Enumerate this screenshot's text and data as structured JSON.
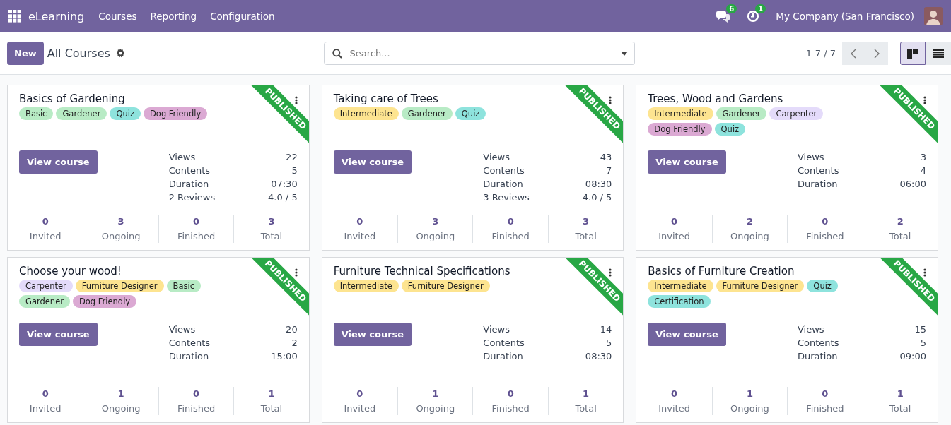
{
  "navbar": {
    "app_name": "eLearning",
    "menu": [
      "Courses",
      "Reporting",
      "Configuration"
    ],
    "messages_count": "6",
    "activities_count": "1",
    "company": "My Company (San Francisco)"
  },
  "control_panel": {
    "new_button": "New",
    "breadcrumb": "All Courses",
    "search": {
      "placeholder": "Search..."
    },
    "pager": "1-7 / 7",
    "views": [
      {
        "kind": "kanban",
        "selected": true
      },
      {
        "kind": "list",
        "selected": false
      }
    ]
  },
  "courses": [
    {
      "title": "Basics of Gardening",
      "ribbon": "PUBLISHED",
      "tags": [
        {
          "label": "Basic",
          "color": "#b8ebc5"
        },
        {
          "label": "Gardener",
          "color": "#b8ebc5"
        },
        {
          "label": "Quiz",
          "color": "#8ee3dd"
        },
        {
          "label": "Dog Friendly",
          "color": "#dba9d3"
        }
      ],
      "button": "View course",
      "stats": [
        {
          "label": "Views",
          "value": "22"
        },
        {
          "label": "Contents",
          "value": "5"
        },
        {
          "label": "Duration",
          "value": "07:30"
        },
        {
          "label": "2 Reviews",
          "value": "4.0 / 5"
        }
      ],
      "counts": [
        {
          "value": "0",
          "label": "Invited"
        },
        {
          "value": "3",
          "label": "Ongoing"
        },
        {
          "value": "0",
          "label": "Finished"
        },
        {
          "value": "3",
          "label": "Total"
        }
      ]
    },
    {
      "title": "Taking care of Trees",
      "ribbon": "PUBLISHED",
      "tags": [
        {
          "label": "Intermediate",
          "color": "#fde490"
        },
        {
          "label": "Gardener",
          "color": "#b8ebc5"
        },
        {
          "label": "Quiz",
          "color": "#8ee3dd"
        }
      ],
      "button": "View course",
      "stats": [
        {
          "label": "Views",
          "value": "43"
        },
        {
          "label": "Contents",
          "value": "7"
        },
        {
          "label": "Duration",
          "value": "08:30"
        },
        {
          "label": "3 Reviews",
          "value": "4.0 / 5"
        }
      ],
      "counts": [
        {
          "value": "0",
          "label": "Invited"
        },
        {
          "value": "3",
          "label": "Ongoing"
        },
        {
          "value": "0",
          "label": "Finished"
        },
        {
          "value": "3",
          "label": "Total"
        }
      ]
    },
    {
      "title": "Trees, Wood and Gardens",
      "ribbon": "PUBLISHED",
      "tags": [
        {
          "label": "Intermediate",
          "color": "#fde490"
        },
        {
          "label": "Gardener",
          "color": "#b8ebc5"
        },
        {
          "label": "Carpenter",
          "color": "#e4dbfa"
        },
        {
          "label": "Dog Friendly",
          "color": "#dba9d3"
        },
        {
          "label": "Quiz",
          "color": "#8ee3dd"
        }
      ],
      "button": "View course",
      "stats": [
        {
          "label": "Views",
          "value": "3"
        },
        {
          "label": "Contents",
          "value": "4"
        },
        {
          "label": "Duration",
          "value": "06:00"
        }
      ],
      "counts": [
        {
          "value": "0",
          "label": "Invited"
        },
        {
          "value": "2",
          "label": "Ongoing"
        },
        {
          "value": "0",
          "label": "Finished"
        },
        {
          "value": "2",
          "label": "Total"
        }
      ]
    },
    {
      "title": "Choose your wood!",
      "ribbon": "PUBLISHED",
      "tags": [
        {
          "label": "Carpenter",
          "color": "#e4dbfa"
        },
        {
          "label": "Furniture Designer",
          "color": "#fde490"
        },
        {
          "label": "Basic",
          "color": "#b8ebc5"
        },
        {
          "label": "Gardener",
          "color": "#b8ebc5"
        },
        {
          "label": "Dog Friendly",
          "color": "#dba9d3"
        }
      ],
      "button": "View course",
      "stats": [
        {
          "label": "Views",
          "value": "20"
        },
        {
          "label": "Contents",
          "value": "2"
        },
        {
          "label": "Duration",
          "value": "15:00"
        }
      ],
      "counts": [
        {
          "value": "0",
          "label": "Invited"
        },
        {
          "value": "1",
          "label": "Ongoing"
        },
        {
          "value": "0",
          "label": "Finished"
        },
        {
          "value": "1",
          "label": "Total"
        }
      ]
    },
    {
      "title": "Furniture Technical Specifications",
      "ribbon": "PUBLISHED",
      "tags": [
        {
          "label": "Intermediate",
          "color": "#fde490"
        },
        {
          "label": "Furniture Designer",
          "color": "#fde490"
        }
      ],
      "button": "View course",
      "stats": [
        {
          "label": "Views",
          "value": "14"
        },
        {
          "label": "Contents",
          "value": "5"
        },
        {
          "label": "Duration",
          "value": "08:30"
        }
      ],
      "counts": [
        {
          "value": "0",
          "label": "Invited"
        },
        {
          "value": "1",
          "label": "Ongoing"
        },
        {
          "value": "0",
          "label": "Finished"
        },
        {
          "value": "1",
          "label": "Total"
        }
      ]
    },
    {
      "title": "Basics of Furniture Creation",
      "ribbon": "PUBLISHED",
      "tags": [
        {
          "label": "Intermediate",
          "color": "#fde490"
        },
        {
          "label": "Furniture Designer",
          "color": "#fde490"
        },
        {
          "label": "Quiz",
          "color": "#8ee3dd"
        },
        {
          "label": "Certification",
          "color": "#8ee3dd"
        }
      ],
      "button": "View course",
      "stats": [
        {
          "label": "Views",
          "value": "15"
        },
        {
          "label": "Contents",
          "value": "5"
        },
        {
          "label": "Duration",
          "value": "09:00"
        }
      ],
      "counts": [
        {
          "value": "0",
          "label": "Invited"
        },
        {
          "value": "1",
          "label": "Ongoing"
        },
        {
          "value": "0",
          "label": "Finished"
        },
        {
          "value": "1",
          "label": "Total"
        }
      ]
    }
  ]
}
